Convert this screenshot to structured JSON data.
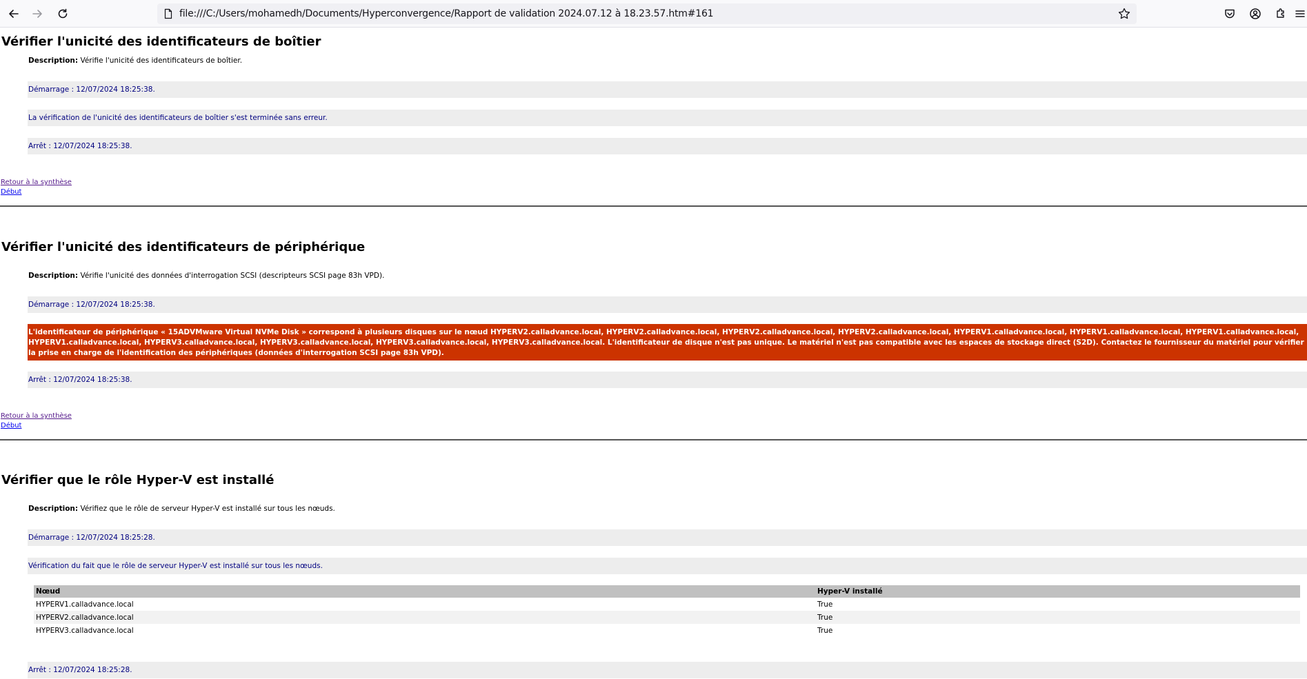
{
  "browser": {
    "url": "file:///C:/Users/mohamedh/Documents/Hyperconvergence/Rapport de validation 2024.07.12 à 18.23.57.htm#161",
    "icons": [
      "back-icon",
      "forward-icon",
      "reload-icon",
      "page-icon",
      "bookmark-star-icon",
      "pocket-icon",
      "account-icon",
      "extensions-icon",
      "menu-icon"
    ]
  },
  "sections": [
    {
      "title": "Vérifier l'unicité des identificateurs de boîtier",
      "description_label": "Description:",
      "description": " Vérifie l'unicité des identificateurs de boîtier.",
      "start": "Démarrage : 12/07/2024 18:25:38.",
      "message": "La vérification de l'unicité des identificateurs de boîtier s'est terminée sans erreur.",
      "stop": "Arrêt : 12/07/2024 18:25:38.",
      "link_summary": "Retour à la synthèse",
      "link_top": "Début"
    },
    {
      "title": "Vérifier l'unicité des identificateurs de périphérique",
      "description_label": "Description:",
      "description": " Vérifie l'unicité des données d'interrogation SCSI (descripteurs SCSI page 83h VPD).",
      "start": "Démarrage : 12/07/2024 18:25:38.",
      "error": "L'identificateur de périphérique « 15ADVMware Virtual NVMe Disk » correspond à plusieurs disques sur le nœud HYPERV2.calladvance.local, HYPERV2.calladvance.local, HYPERV2.calladvance.local, HYPERV2.calladvance.local, HYPERV1.calladvance.local, HYPERV1.calladvance.local, HYPERV1.calladvance.local, HYPERV1.calladvance.local, HYPERV3.calladvance.local, HYPERV3.calladvance.local, HYPERV3.calladvance.local, HYPERV3.calladvance.local. L'identificateur de disque n'est pas unique. Le matériel n'est pas compatible avec les espaces de stockage direct (S2D). Contactez le fournisseur du matériel pour vérifier la prise en charge de l'identification des périphériques (données d'interrogation SCSI page 83h VPD).",
      "error_color": "#cc3300",
      "stop": "Arrêt : 12/07/2024 18:25:38.",
      "link_summary": "Retour à la synthèse",
      "link_top": "Début"
    },
    {
      "title": "Vérifier que le rôle Hyper-V est installé",
      "description_label": "Description:",
      "description": " Vérifiez que le rôle de serveur Hyper-V est installé sur tous les nœuds.",
      "start": "Démarrage : 12/07/2024 18:25:28.",
      "message": "Vérification du fait que le rôle de serveur Hyper-V est installé sur tous les nœuds.",
      "table": {
        "headers": [
          "Nœud",
          "Hyper-V installé"
        ],
        "rows": [
          [
            "HYPERV1.calladvance.local",
            "True"
          ],
          [
            "HYPERV2.calladvance.local",
            "True"
          ],
          [
            "HYPERV3.calladvance.local",
            "True"
          ]
        ]
      },
      "stop": "Arrêt : 12/07/2024 18:25:28."
    }
  ]
}
